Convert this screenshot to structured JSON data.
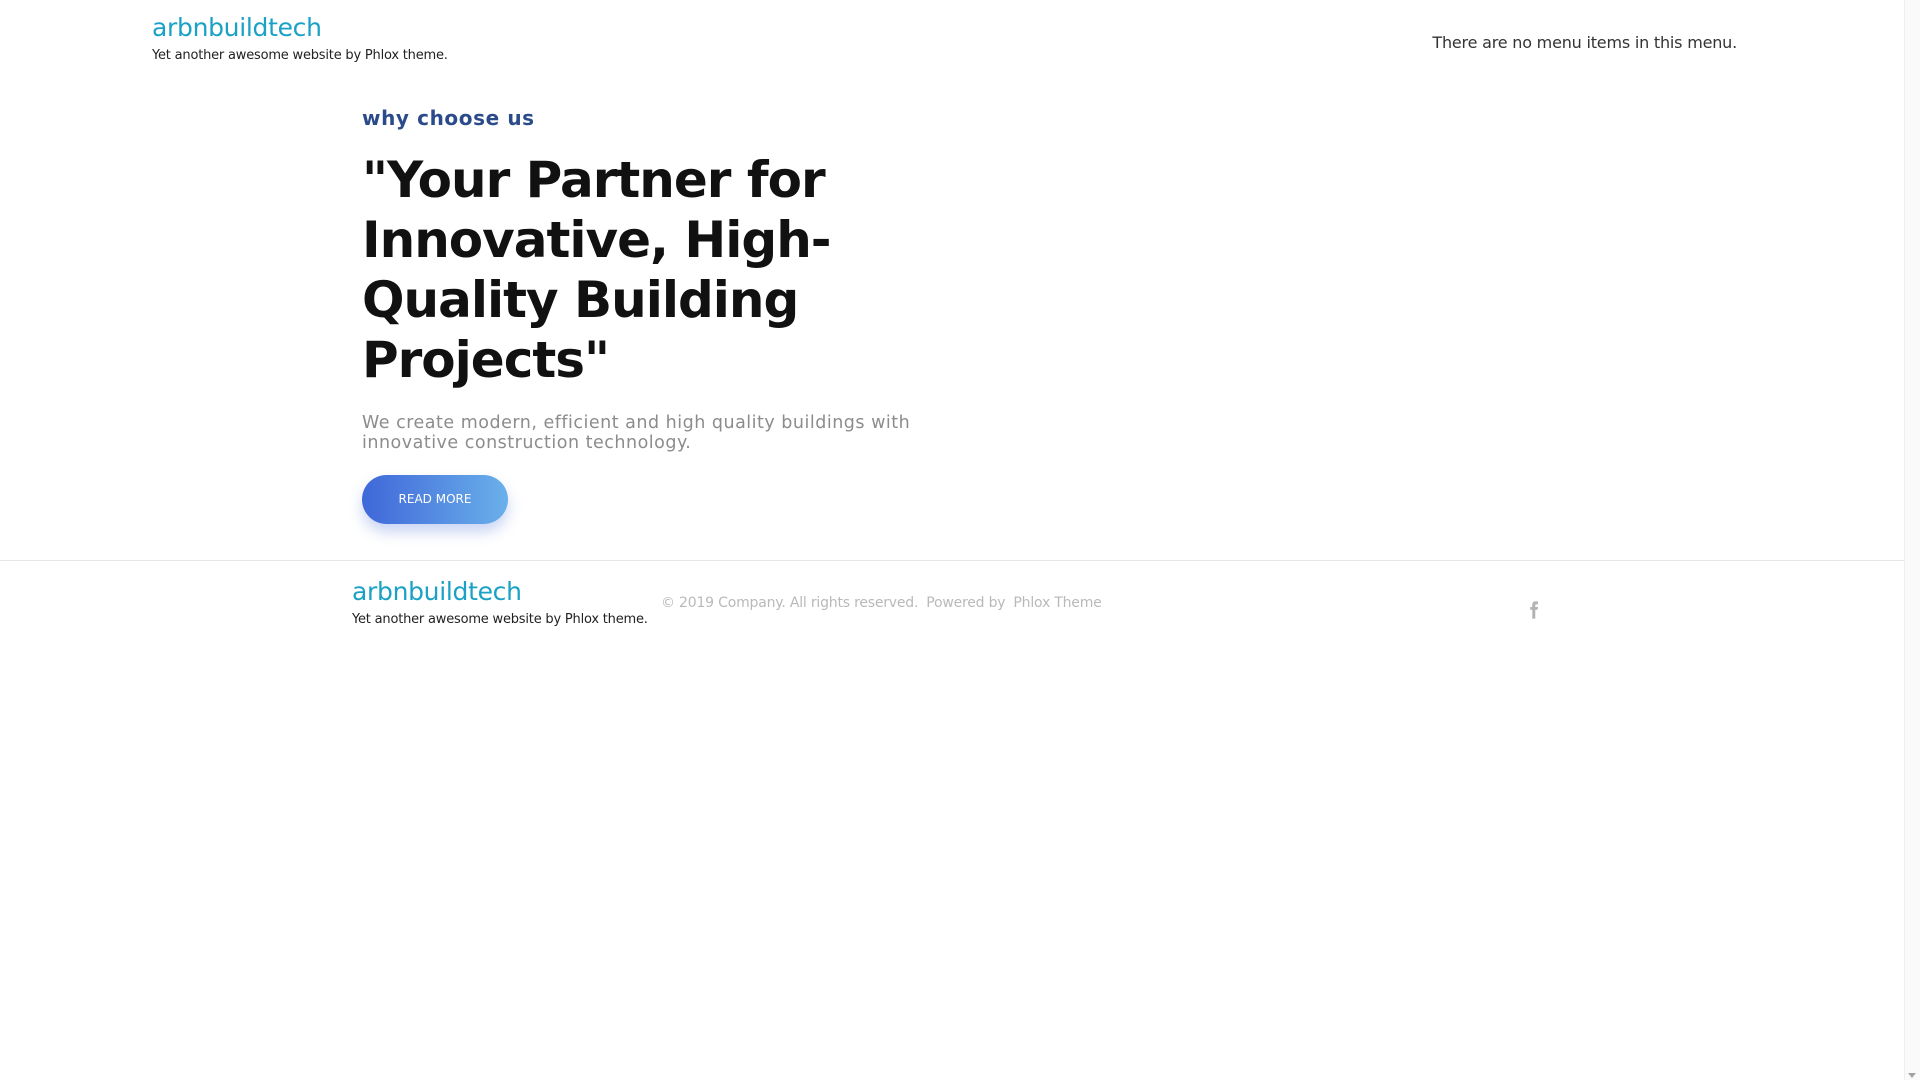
{
  "header": {
    "site_title": "arbnbuildtech",
    "tagline": "Yet another awesome website by Phlox theme.",
    "menu_note": "There are no menu items in this menu."
  },
  "hero": {
    "eyebrow": "why choose us",
    "title": "\"Your Partner for Innovative, High-Quality Building Projects\"",
    "text": "We create modern, efficient and high quality buildings with innovative construction technology.",
    "button_label": "READ MORE"
  },
  "footer": {
    "site_title": "arbnbuildtech",
    "tagline": "Yet another awesome website by Phlox theme.",
    "copyright": "© 2019 Company. All rights reserved.",
    "powered_by": "Powered by",
    "theme_link": "Phlox Theme",
    "social_icon": "facebook-icon"
  },
  "colors": {
    "brand": "#1aa1c6",
    "eyebrow": "#2a4a8a",
    "button_start": "#3f67d9",
    "button_end": "#6ab0ea",
    "footer_text": "#b9b9b9"
  }
}
